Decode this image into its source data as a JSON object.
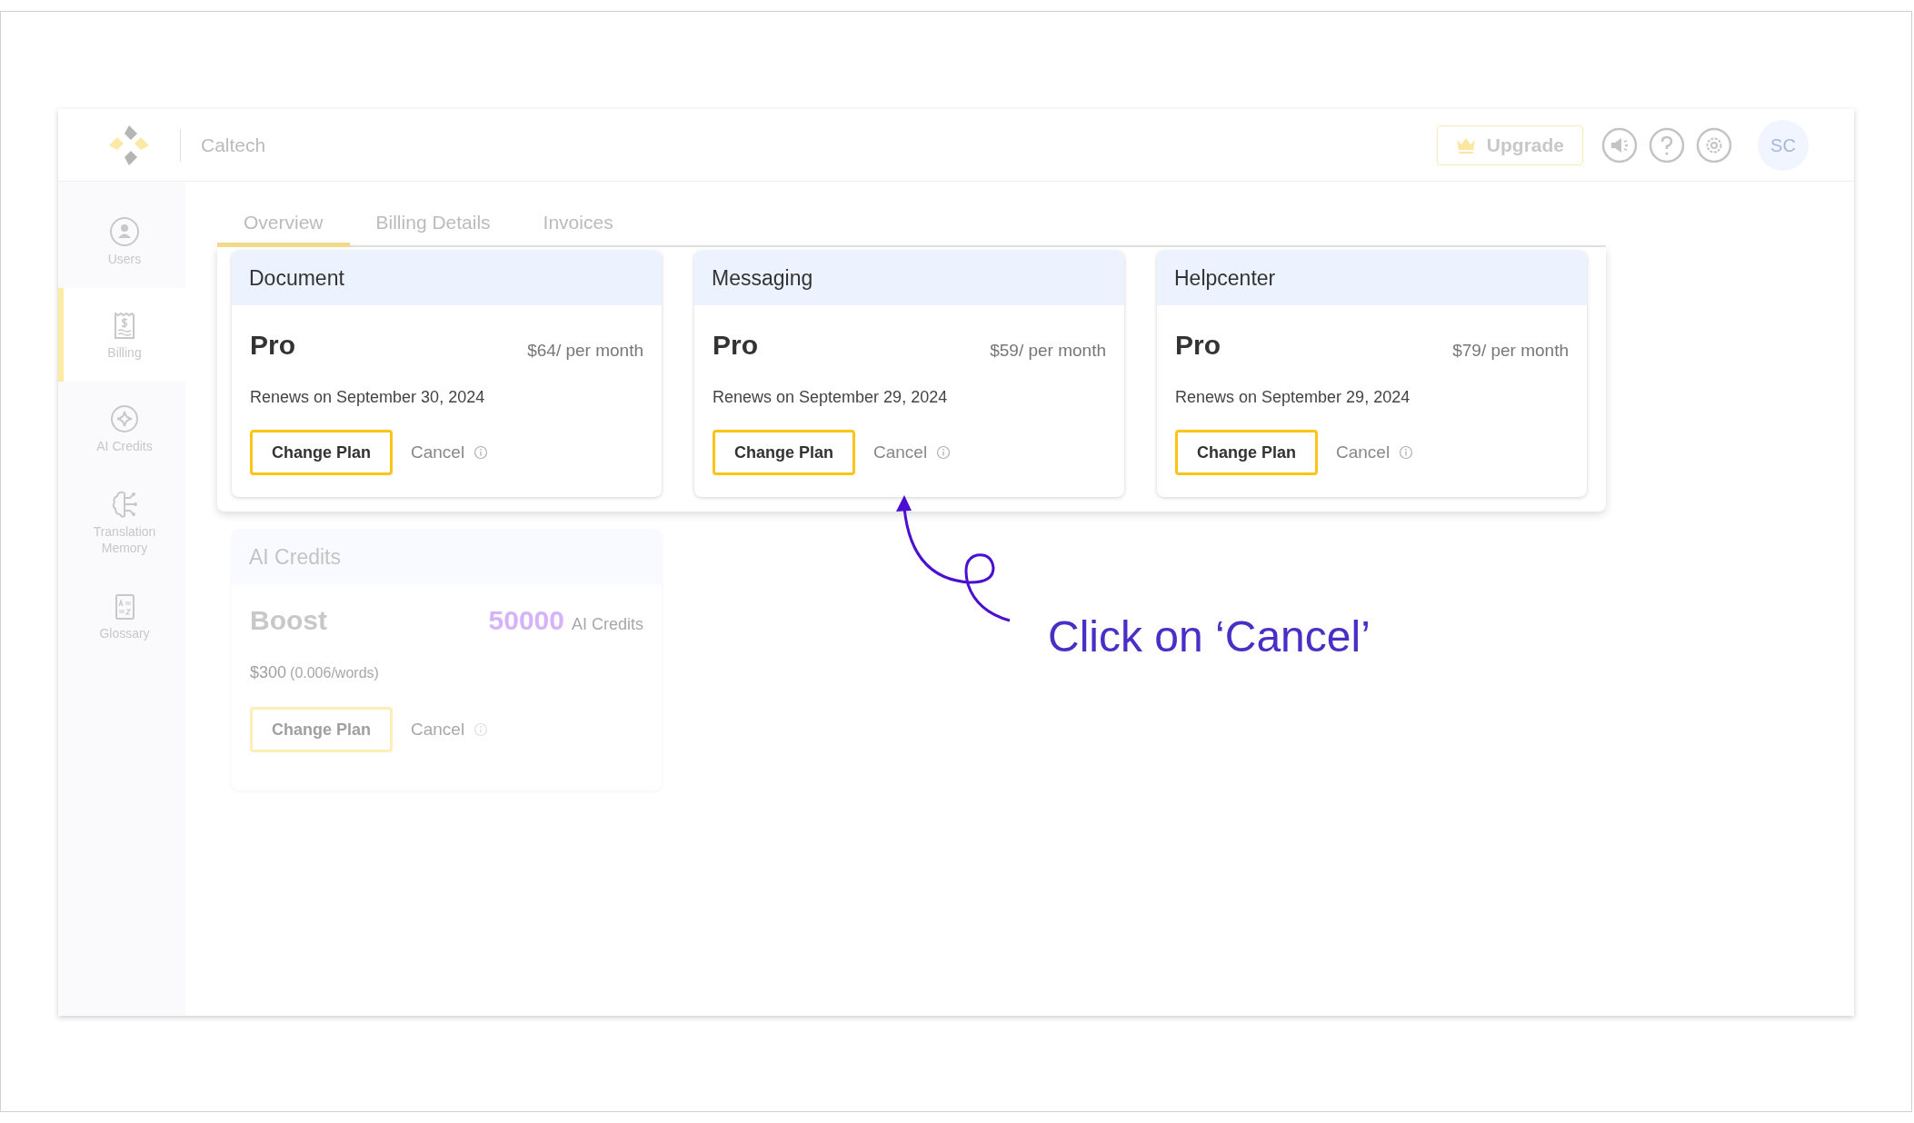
{
  "header": {
    "org_name": "Caltech",
    "upgrade_label": "Upgrade",
    "avatar_initials": "SC"
  },
  "sidebar": {
    "items": [
      {
        "label": "Users",
        "selected": false
      },
      {
        "label": "Billing",
        "selected": true
      },
      {
        "label": "AI Credits",
        "selected": false
      },
      {
        "label": "Translation Memory",
        "selected": false
      },
      {
        "label": "Glossary",
        "selected": false
      }
    ]
  },
  "tabs": [
    {
      "label": "Overview",
      "selected": true
    },
    {
      "label": "Billing Details",
      "selected": false
    },
    {
      "label": "Invoices",
      "selected": false
    }
  ],
  "subscriptions": [
    {
      "product": "Document",
      "plan": "Pro",
      "price": "$64/ per month",
      "renews": "Renews on September 30, 2024",
      "change_label": "Change Plan",
      "cancel_label": "Cancel"
    },
    {
      "product": "Messaging",
      "plan": "Pro",
      "price": "$59/ per month",
      "renews": "Renews on September 29, 2024",
      "change_label": "Change Plan",
      "cancel_label": "Cancel"
    },
    {
      "product": "Helpcenter",
      "plan": "Pro",
      "price": "$79/ per month",
      "renews": "Renews on September 29, 2024",
      "change_label": "Change Plan",
      "cancel_label": "Cancel"
    }
  ],
  "ai_credits": {
    "title": "AI Credits",
    "plan": "Boost",
    "amount": "50000",
    "amount_unit": "AI Credits",
    "price": "$300",
    "rate": "(0.006/words)",
    "change_label": "Change Plan",
    "cancel_label": "Cancel"
  },
  "annotation": {
    "text": "Click on ‘Cancel’"
  }
}
